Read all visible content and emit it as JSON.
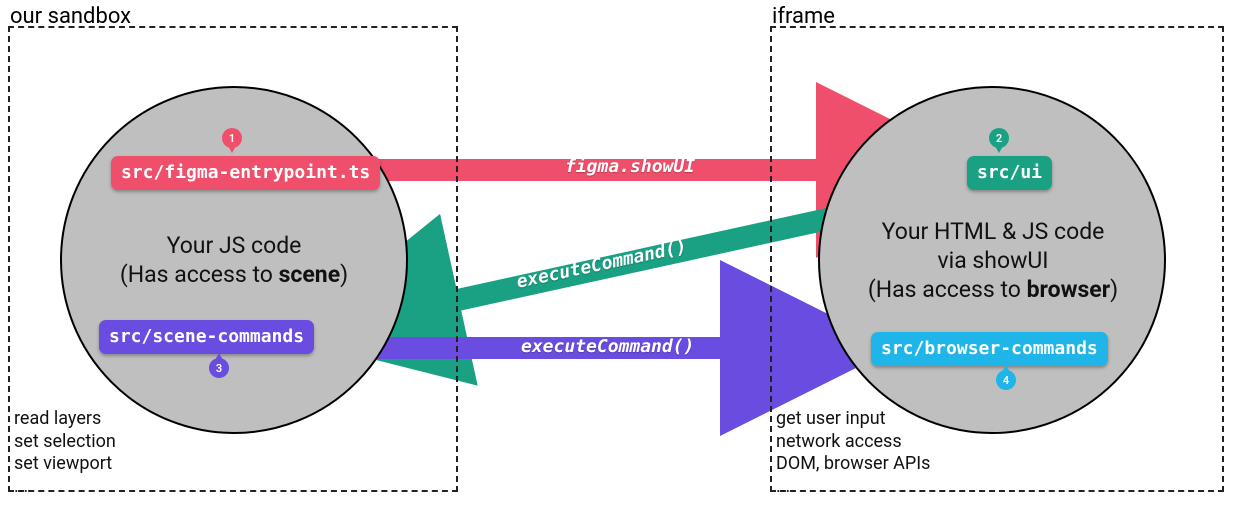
{
  "left_title": "our sandbox",
  "right_title": "iframe",
  "left_desc_line1": "Your JS code",
  "left_desc_line2_pre": "(Has access to ",
  "left_desc_line2_bold": "scene",
  "left_desc_line2_post": ")",
  "right_desc_line1": "Your  HTML & JS code",
  "right_desc_line2": "via showUI",
  "right_desc_line3_pre": "(Has access to ",
  "right_desc_line3_bold": "browser",
  "right_desc_line3_post": ")",
  "tags": {
    "entrypoint": "src/figma-entrypoint.ts",
    "ui": "src/ui",
    "scene": "src/scene-commands",
    "browser": "src/browser-commands"
  },
  "pins": {
    "p1": "1",
    "p2": "2",
    "p3": "3",
    "p4": "4"
  },
  "arrows": {
    "showUI": "figma.showUI",
    "exec1": "executeCommand()",
    "exec2": "executeCommand()"
  },
  "caps_left": {
    "a": "read layers",
    "b": "set selection",
    "c": "set viewport",
    "d": "..."
  },
  "caps_right": {
    "a": "get user input",
    "b": "network access",
    "c": "DOM, browser APIs",
    "d": "..."
  },
  "colors": {
    "red": "#ef4f6b",
    "green": "#1aa183",
    "purple": "#6a4ce0",
    "cyan": "#1fb5e9"
  }
}
